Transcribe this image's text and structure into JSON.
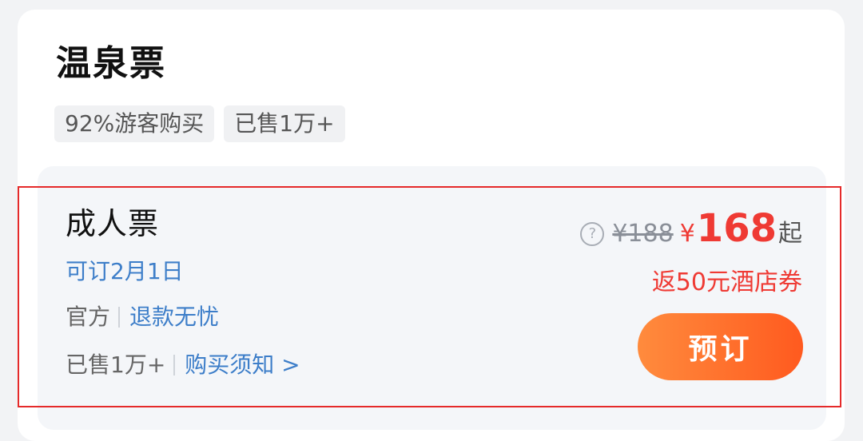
{
  "section": {
    "title": "温泉票",
    "tags": [
      "92%游客购买",
      "已售1万+"
    ]
  },
  "ticket": {
    "name": "成人票",
    "availability": "可订2月1日",
    "source": "官方",
    "refund": "退款无忧",
    "sold": "已售1万+",
    "notice": "购买须知 >",
    "help_icon": "?",
    "original_price": "¥188",
    "currency": "¥",
    "price": "168",
    "price_suffix": "起",
    "coupon": "返50元酒店券",
    "book_label": "预订"
  },
  "colors": {
    "accent_red": "#ef3a34",
    "link_blue": "#3d7ec9",
    "button_start": "#ff8b3d",
    "button_end": "#ff5a1f",
    "highlight_border": "#e52a2a"
  }
}
